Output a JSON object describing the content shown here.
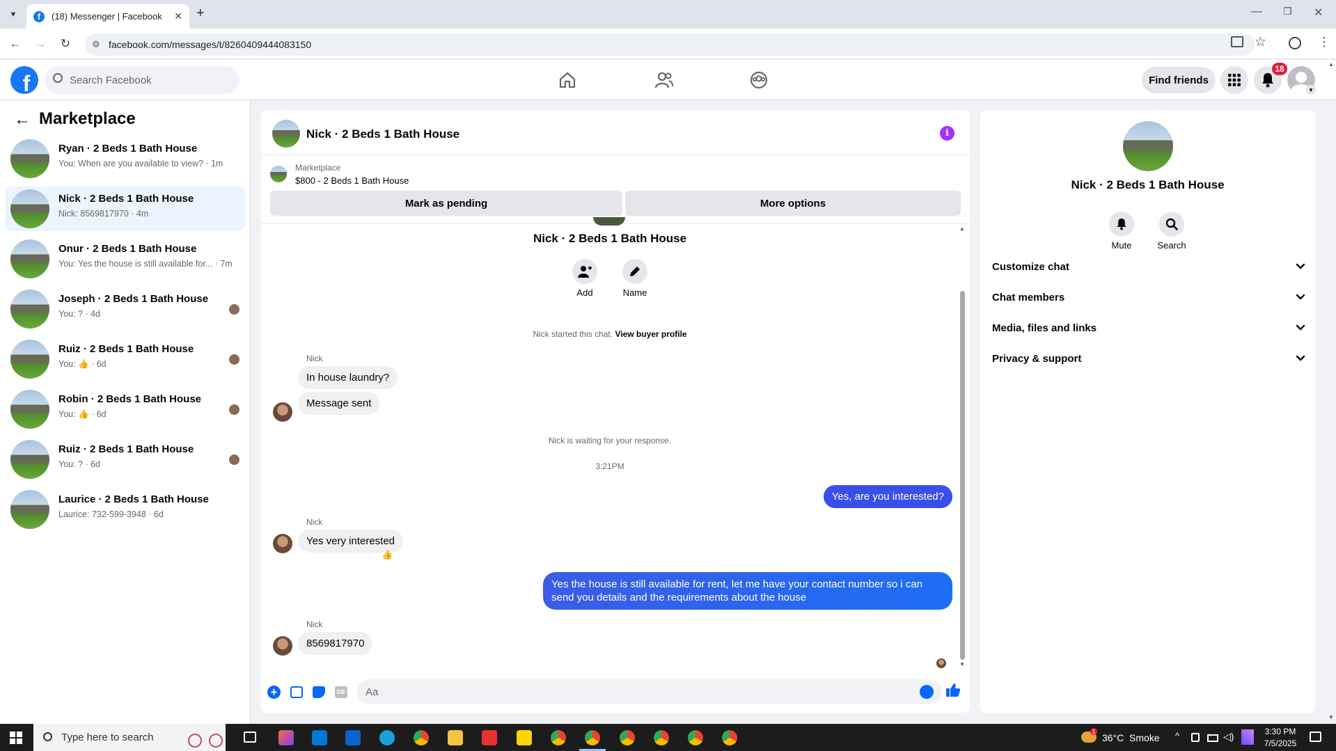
{
  "browser": {
    "tab_title": "(18) Messenger | Facebook",
    "url": "facebook.com/messages/t/8260409444083150"
  },
  "fb_header": {
    "search_placeholder": "Search Facebook",
    "find_friends": "Find friends",
    "notification_count": "18"
  },
  "left": {
    "title": "Marketplace",
    "conversations": [
      {
        "name": "Ryan · 2 Beds 1 Bath House",
        "preview": "You: When are you available to view? · 1m"
      },
      {
        "name": "Nick · 2 Beds 1 Bath House",
        "preview": "Nick: 8569817970 · 4m"
      },
      {
        "name": "Onur · 2 Beds 1 Bath House",
        "preview": "You: Yes the house is still available for...  · 7m"
      },
      {
        "name": "Joseph · 2 Beds 1 Bath House",
        "preview": "You: ? · 4d"
      },
      {
        "name": "Ruiz · 2 Beds 1 Bath House",
        "preview": "You: 👍 · 6d"
      },
      {
        "name": "Robin · 2 Beds 1 Bath House",
        "preview": "You: 👍 · 6d"
      },
      {
        "name": "Ruiz · 2 Beds 1 Bath House",
        "preview": "You: ? · 6d"
      },
      {
        "name": "Laurice · 2 Beds 1 Bath House",
        "preview": "Laurice: 732-599-3948 · 6d"
      }
    ]
  },
  "chat": {
    "header_title": "Nick · 2 Beds 1 Bath House",
    "pinned_source": "Marketplace",
    "pinned_listing": "$800 - 2 Beds 1 Bath House",
    "mark_pending": "Mark as pending",
    "more_options": "More options",
    "intro_name": "Nick · 2 Beds 1 Bath House",
    "add_label": "Add",
    "name_label": "Name",
    "started_note": "Nick started this chat.",
    "buyer_profile_link": "View buyer profile",
    "sender_name": "Nick",
    "msg1": "In house laundry?",
    "msg2": "Message sent",
    "waiting_note": "Nick is waiting for your response.",
    "timestamp": "3:21PM",
    "out1": "Yes, are you interested?",
    "msg3": "Yes very interested",
    "msg3_reaction": "👍",
    "out2": "Yes the house is still available for rent, let me have your contact number so i can send you details and the requirements about the house",
    "msg4": "8569817970",
    "composer_placeholder": "Aa"
  },
  "details": {
    "title": "Nick · 2 Beds 1 Bath House",
    "mute": "Mute",
    "search": "Search",
    "sections": [
      "Customize chat",
      "Chat members",
      "Media, files and links",
      "Privacy & support"
    ]
  },
  "taskbar": {
    "search_placeholder": "Type here to search",
    "weather": "36°C  Smoke",
    "time": "3:30 PM",
    "date": "7/5/2025",
    "weather_badge": "1"
  }
}
